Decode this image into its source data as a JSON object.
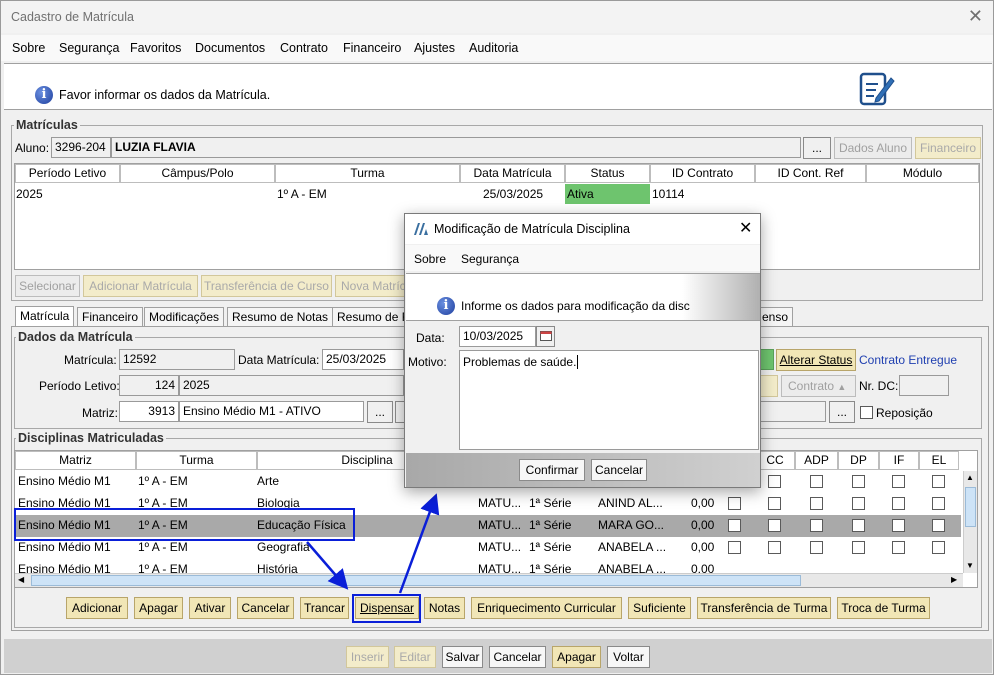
{
  "window": {
    "title": "Cadastro de Matrícula"
  },
  "menu": [
    "Sobre",
    "Segurança",
    "Favoritos",
    "Documentos",
    "Contrato",
    "Financeiro",
    "Ajustes",
    "Auditoria"
  ],
  "banner": {
    "text": "Favor informar os dados da Matrícula."
  },
  "matriculas": {
    "group_label": "Matrículas",
    "aluno_label": "Aluno:",
    "aluno_code": "3296-204",
    "aluno_name": "LUZIA FLAVIA",
    "ellipsis": "...",
    "dados_aluno_btn": "Dados Aluno",
    "financeiro_btn": "Financeiro",
    "columns": [
      "Período Letivo",
      "Câmpus/Polo",
      "Turma",
      "Data Matrícula",
      "Status",
      "ID Contrato",
      "ID Cont. Ref",
      "Módulo"
    ],
    "row": {
      "periodo": "2025",
      "campus": "",
      "turma": "1º A - EM",
      "data": "25/03/2025",
      "status": "Ativa",
      "id_contrato": "10114",
      "id_ref": "",
      "modulo": ""
    },
    "buttons": [
      "Selecionar",
      "Adicionar Matrícula",
      "Transferência de Curso",
      "Nova Matríc"
    ]
  },
  "tabs": [
    "Matrícula",
    "Financeiro",
    "Modificações",
    "Resumo de Notas",
    "Resumo de F",
    "enso"
  ],
  "dados": {
    "group_label": "Dados da Matrícula",
    "matricula_label": "Matrícula:",
    "matricula_value": "12592",
    "data_label": "Data Matrícula:",
    "data_value": "25/03/2025",
    "periodo_label": "Período Letivo:",
    "periodo_code": "124",
    "periodo_value": "2025",
    "matriz_label": "Matriz:",
    "matriz_code": "3913",
    "matriz_value": "Ensino Médio M1 - ATIVO",
    "alterar_status": "Alterar Status",
    "contrato_entregue": "Contrato Entregue",
    "contrato_btn": "Contrato",
    "nr_dc_label": "Nr. DC:",
    "reposicao_label": "Reposição"
  },
  "disciplinas": {
    "group_label": "Disciplinas Matriculadas",
    "columns": [
      "Matriz",
      "Turma",
      "Disciplina",
      "CC",
      "ADP",
      "DP",
      "IF",
      "EL"
    ],
    "rows": [
      {
        "matriz": "Ensino Médio M1",
        "turma": "1º A - EM",
        "disciplina": "Arte",
        "c4": "",
        "c5": "",
        "c6": "",
        "c7": ""
      },
      {
        "matriz": "Ensino Médio M1",
        "turma": "1º A - EM",
        "disciplina": "Biologia",
        "c4": "MATU...",
        "c5": "1ª Série",
        "c6": "ANIND AL...",
        "c7": "0,00"
      },
      {
        "matriz": "Ensino Médio M1",
        "turma": "1º A - EM",
        "disciplina": "Educação Física",
        "c4": "MATU...",
        "c5": "1ª Série",
        "c6": "MARA GO...",
        "c7": "0,00"
      },
      {
        "matriz": "Ensino Médio M1",
        "turma": "1º A - EM",
        "disciplina": "Geografia",
        "c4": "MATU...",
        "c5": "1ª Série",
        "c6": "ANABELA ...",
        "c7": "0,00"
      },
      {
        "matriz": "Ensino Médio M1",
        "turma": "1º A - EM",
        "disciplina": "História",
        "c4": "MATU...",
        "c5": "1ª Série",
        "c6": "ANABELA ...",
        "c7": "0,00"
      }
    ],
    "buttons": [
      "Adicionar",
      "Apagar",
      "Ativar",
      "Cancelar",
      "Trancar",
      "Dispensar",
      "Notas",
      "Enriquecimento Curricular",
      "Suficiente",
      "Transferência de Turma",
      "Troca de Turma"
    ]
  },
  "footer": {
    "buttons": [
      "Inserir",
      "Editar",
      "Salvar",
      "Cancelar",
      "Apagar",
      "Voltar"
    ]
  },
  "dialog": {
    "title": "Modificação de Matrícula Disciplina",
    "menu": [
      "Sobre",
      "Segurança"
    ],
    "info": "Informe os dados para modificação da disc",
    "data_label": "Data:",
    "data_value": "10/03/2025",
    "motivo_label": "Motivo:",
    "motivo_value": "Problemas de saúde.",
    "confirmar": "Confirmar",
    "cancelar": "Cancelar"
  },
  "colors": {
    "accent_blue": "#0a1fd8",
    "status_green": "#6ec46e",
    "yellow_button": "#f1e6b6",
    "selected_row": "#a9a9a9"
  }
}
